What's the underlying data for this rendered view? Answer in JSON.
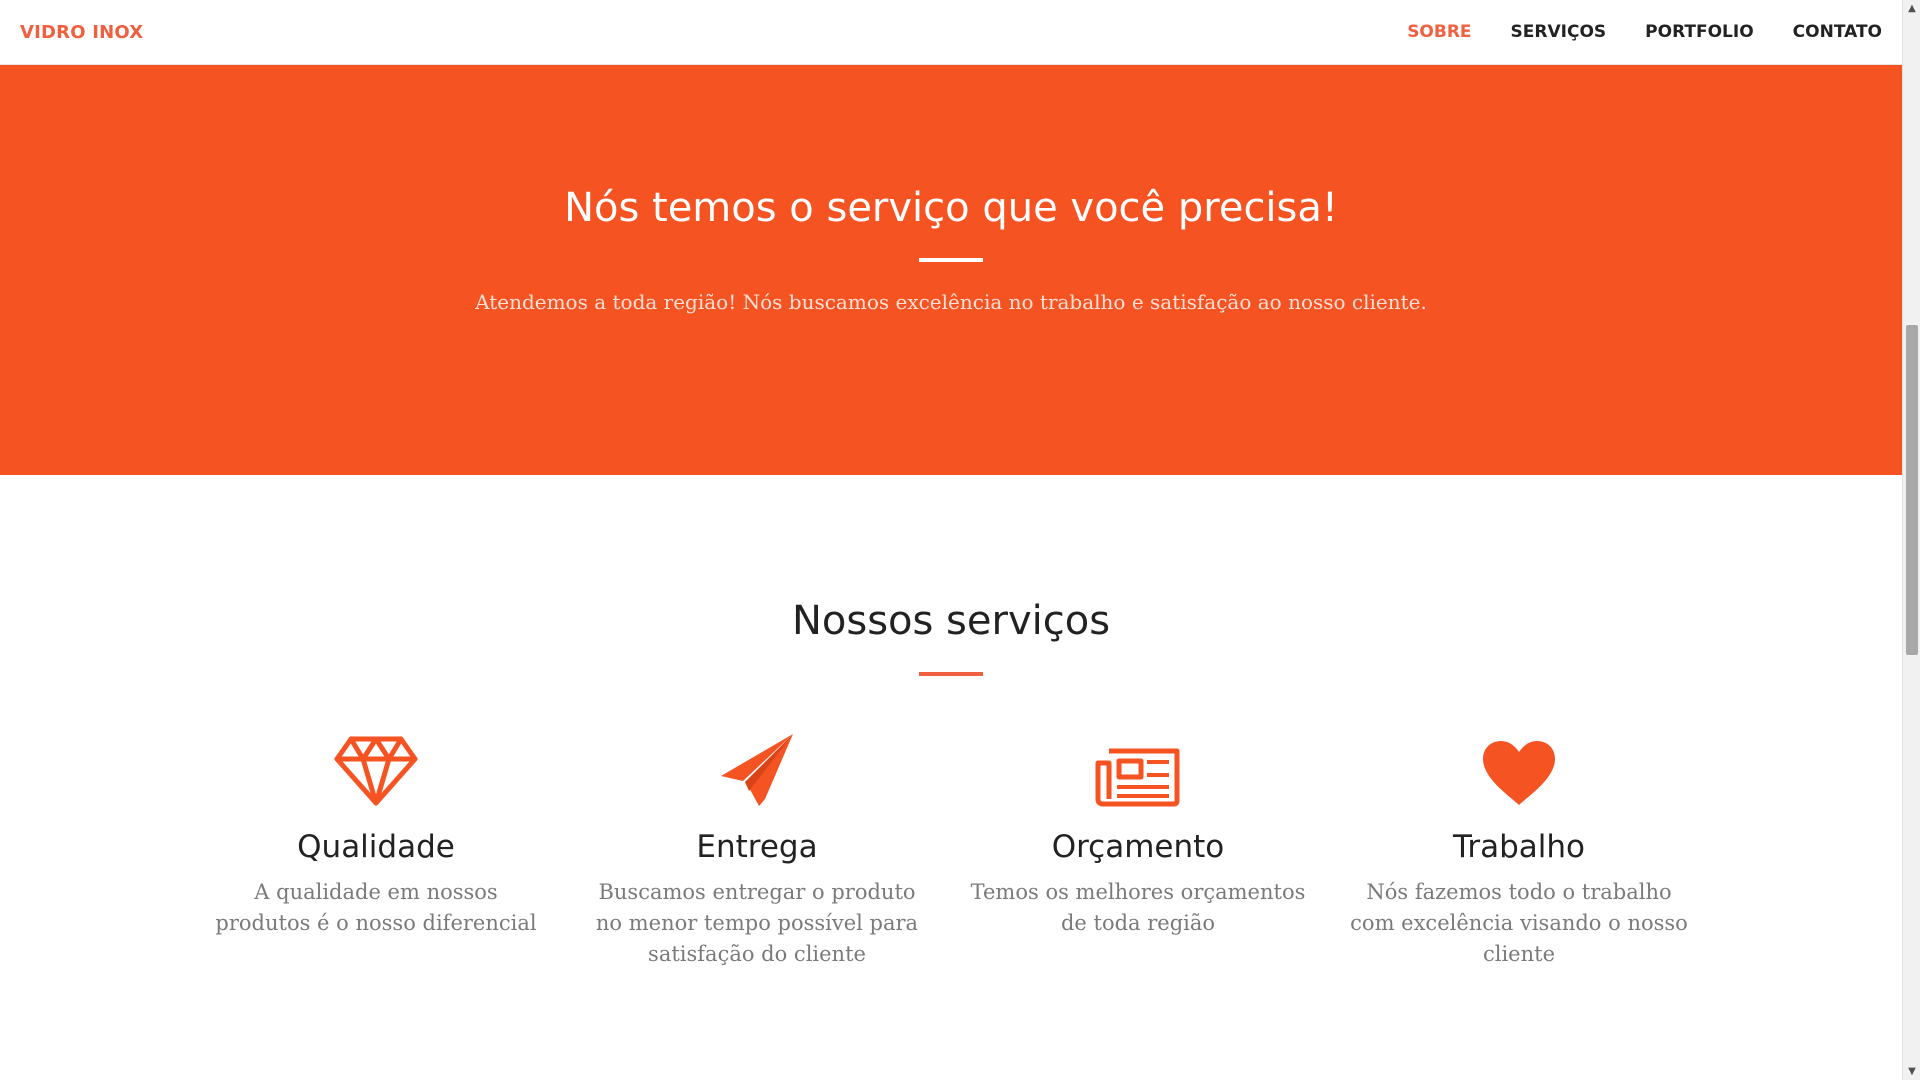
{
  "brand": {
    "label": "VIDRO INOX"
  },
  "nav": {
    "items": [
      {
        "label": "SOBRE",
        "active": true
      },
      {
        "label": "SERVIÇOS",
        "active": false
      },
      {
        "label": "PORTFOLIO",
        "active": false
      },
      {
        "label": "CONTATO",
        "active": false
      }
    ]
  },
  "about": {
    "title": "Nós temos o serviço que você precisa!",
    "text": "Atendemos a toda região! Nós buscamos excelência no trabalho e satisfação ao nosso cliente."
  },
  "services": {
    "title": "Nossos serviços",
    "items": [
      {
        "icon": "diamond-icon",
        "title": "Qualidade",
        "text": "A qualidade em nossos produtos é o nosso diferencial"
      },
      {
        "icon": "paper-plane-icon",
        "title": "Entrega",
        "text": "Buscamos entregar o produto no menor tempo possível para satisfação do cliente"
      },
      {
        "icon": "newspaper-icon",
        "title": "Orçamento",
        "text": "Temos os melhores orçamentos de toda região"
      },
      {
        "icon": "heart-icon",
        "title": "Trabalho",
        "text": "Nós fazemos todo o trabalho com excelência visando o nosso cliente"
      }
    ]
  },
  "colors": {
    "accent": "#f05f40",
    "hero_background": "#f65323",
    "heading_text": "#222222",
    "body_text": "#7a7a7a"
  }
}
